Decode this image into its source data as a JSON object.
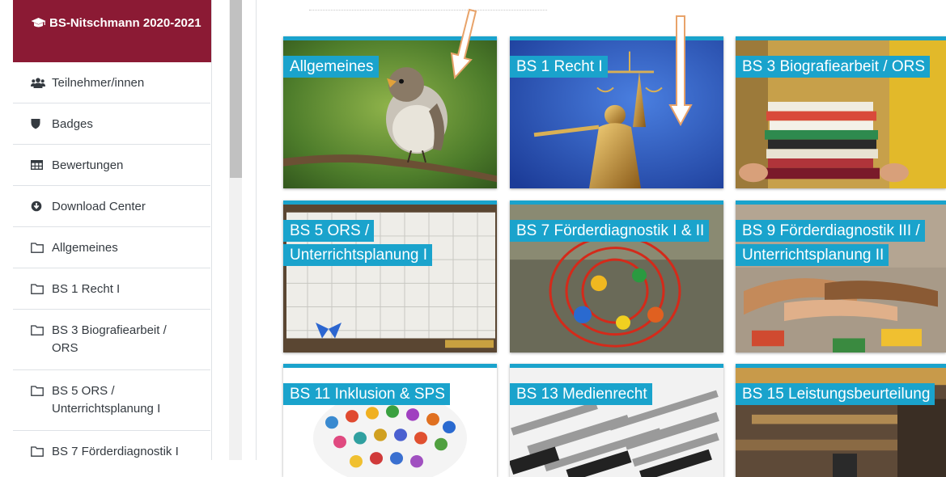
{
  "course": {
    "title": "BS-Nitschmann 2020-2021",
    "icon": "graduation-cap-icon"
  },
  "nav": [
    {
      "label": "Teilnehmer/innen",
      "icon": "users-icon"
    },
    {
      "label": "Badges",
      "icon": "shield-icon"
    },
    {
      "label": "Bewertungen",
      "icon": "table-icon"
    },
    {
      "label": "Download Center",
      "icon": "download-circle-icon"
    },
    {
      "label": "Allgemeines",
      "icon": "folder-icon"
    },
    {
      "label": "BS 1 Recht I",
      "icon": "folder-icon"
    },
    {
      "label": "BS 3 Biografiearbeit / ORS",
      "icon": "folder-icon"
    },
    {
      "label": "BS 5 ORS / Unterrichtsplanung I",
      "icon": "folder-icon"
    },
    {
      "label": "BS 7 Förderdiagnostik I",
      "icon": "folder-icon"
    }
  ],
  "tiles": [
    {
      "title": "Allgemeines"
    },
    {
      "title": "BS 1 Recht I"
    },
    {
      "title": "BS 3 Biografiearbeit / ORS"
    },
    {
      "title": "BS 5 ORS / Unterrichtsplanung I"
    },
    {
      "title": "BS 7 Förderdiagnostik I & II"
    },
    {
      "title": "BS 9 Förderdiagnostik III / Unterrichtsplanung II"
    },
    {
      "title": "BS 11 Inklusion & SPS"
    },
    {
      "title": "BS 13 Medienrecht"
    },
    {
      "title": "BS 15 Leistungsbeurteilung"
    }
  ],
  "colors": {
    "accent": "#1aa3cc",
    "active_nav": "#8b1a34",
    "annotation_arrow": "#e8a36a"
  }
}
